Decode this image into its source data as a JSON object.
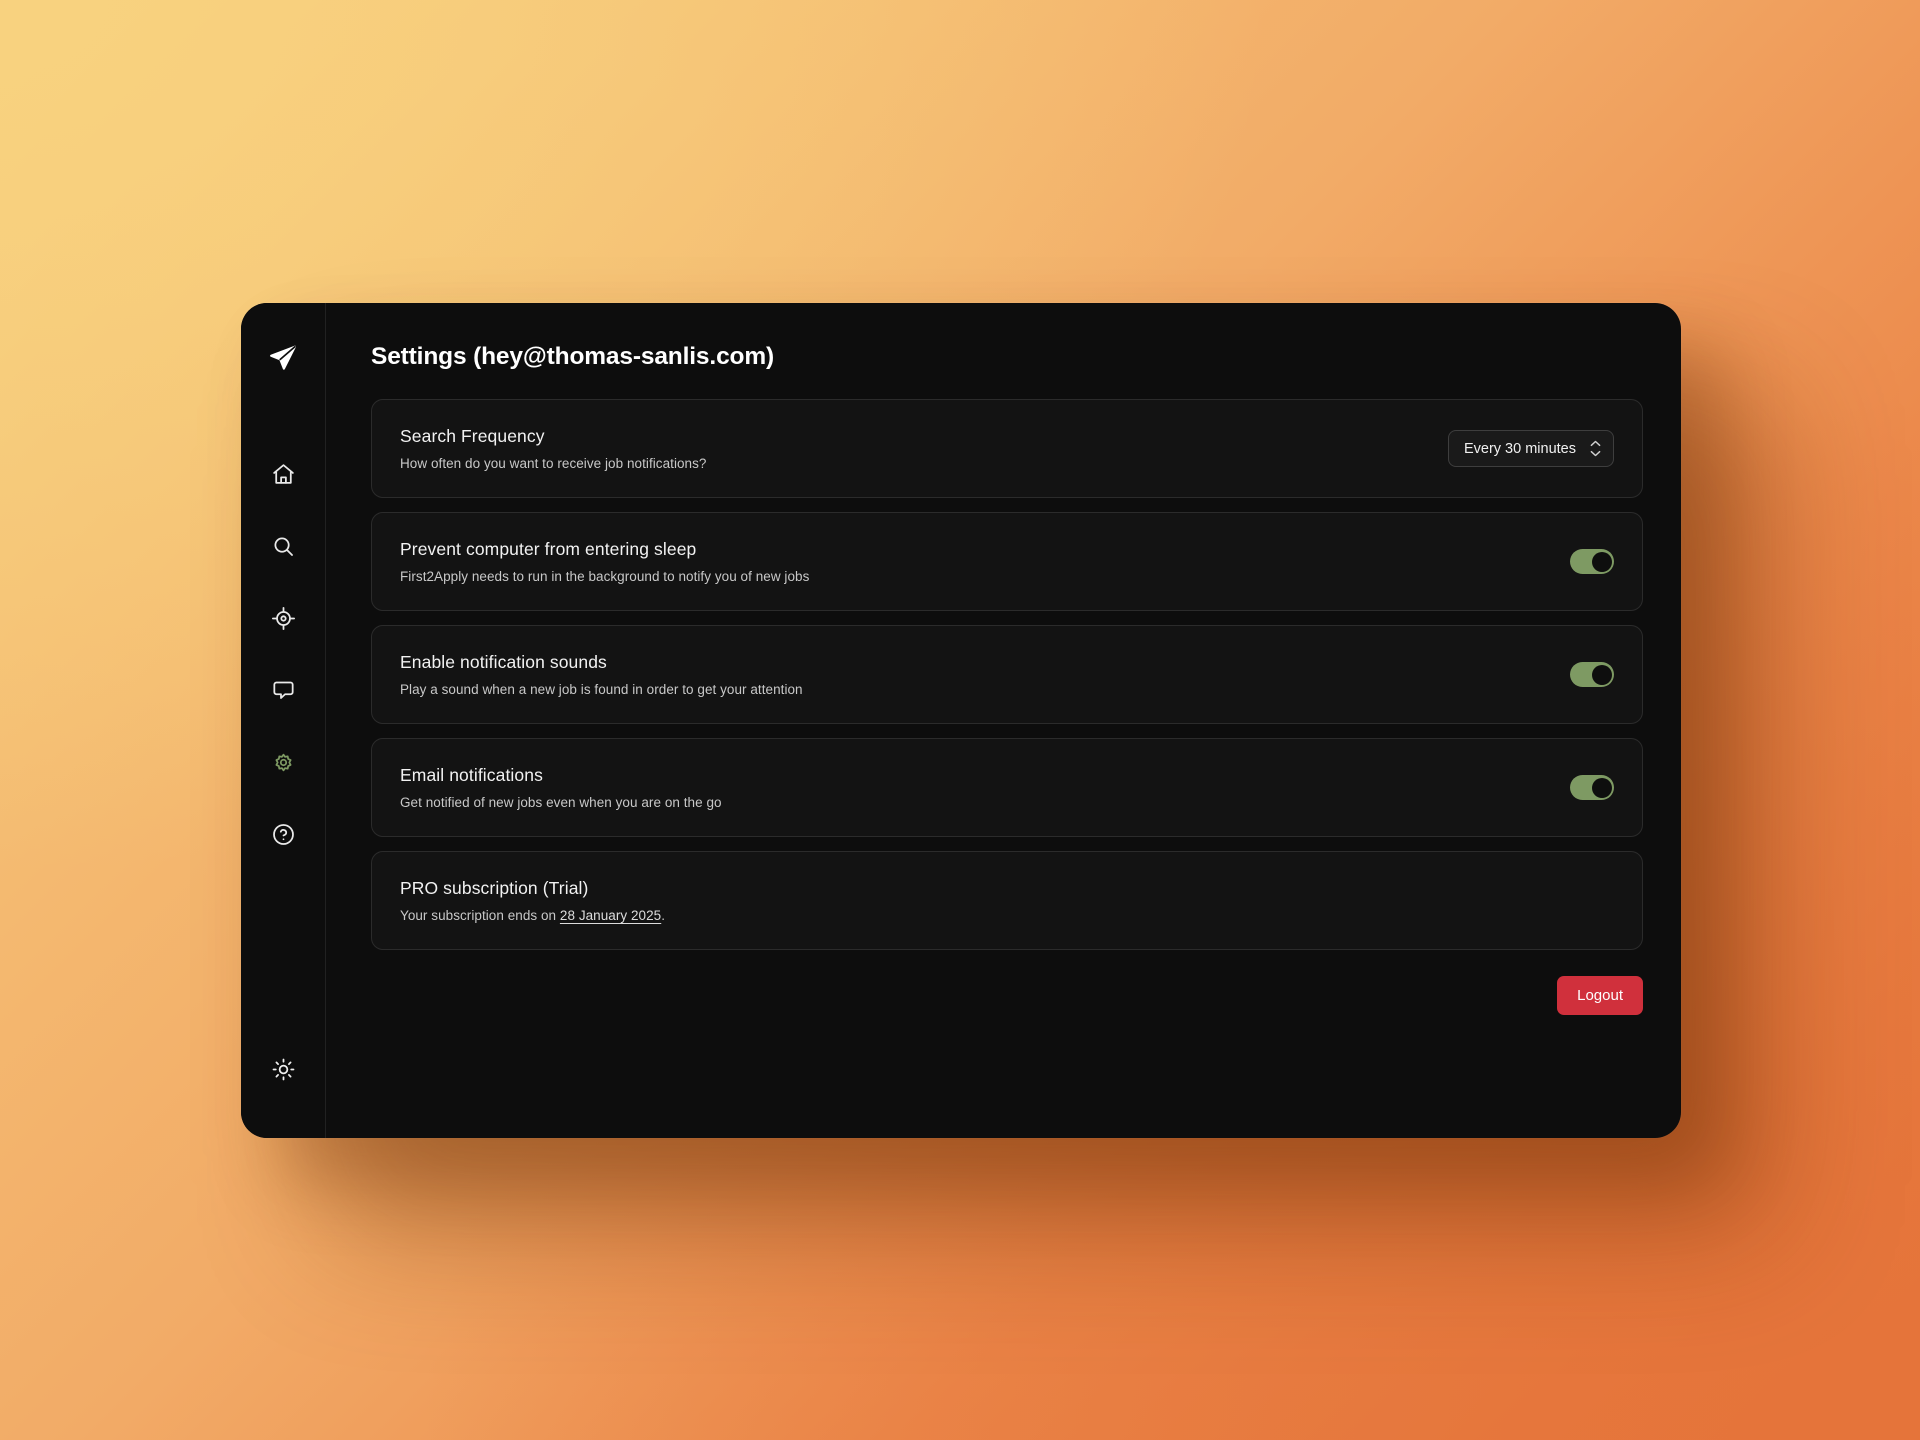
{
  "window": {
    "title": "Settings (hey@thomas-sanlis.com)"
  },
  "sidebar": {
    "logo": {
      "icon": "paper-plane-icon",
      "name": "First2Apply"
    },
    "items": [
      {
        "icon": "home-icon",
        "name": "home",
        "active": false
      },
      {
        "icon": "search-icon",
        "name": "search",
        "active": false
      },
      {
        "icon": "crosshair-icon",
        "name": "job-filters",
        "active": false
      },
      {
        "icon": "chat-icon",
        "name": "feedback",
        "active": false
      },
      {
        "icon": "gear-icon",
        "name": "settings",
        "active": true
      },
      {
        "icon": "help-icon",
        "name": "help",
        "active": false
      }
    ],
    "theme_toggle": {
      "icon": "sun-icon",
      "name": "theme-toggle"
    }
  },
  "settings": [
    {
      "key": "search-frequency",
      "title": "Search Frequency",
      "description": "How often do you want to receive job notifications?",
      "control": "select",
      "select_value": "Every 30 minutes"
    },
    {
      "key": "prevent-sleep",
      "title": "Prevent computer from entering sleep",
      "description": "First2Apply needs to run in the background to notify you of new jobs",
      "control": "toggle",
      "toggle_on": true
    },
    {
      "key": "notification-sounds",
      "title": "Enable notification sounds",
      "description": "Play a sound when a new job is found in order to get your attention",
      "control": "toggle",
      "toggle_on": true
    },
    {
      "key": "email-notifications",
      "title": "Email notifications",
      "description": "Get notified of new jobs even when you are on the go",
      "control": "toggle",
      "toggle_on": true
    },
    {
      "key": "pro-subscription",
      "title": "PRO subscription (Trial)",
      "description_prefix": "Your subscription ends on ",
      "description_link": "28 January 2025",
      "description_suffix": ".",
      "control": "none"
    }
  ],
  "footer": {
    "logout_label": "Logout"
  },
  "colors": {
    "accent_green": "#7e9a63",
    "danger_red": "#d0303c",
    "window_bg": "#0d0d0d",
    "card_bg": "#131313",
    "bg_gradient_start": "#f7cf7e",
    "bg_gradient_end": "#e5743a"
  }
}
